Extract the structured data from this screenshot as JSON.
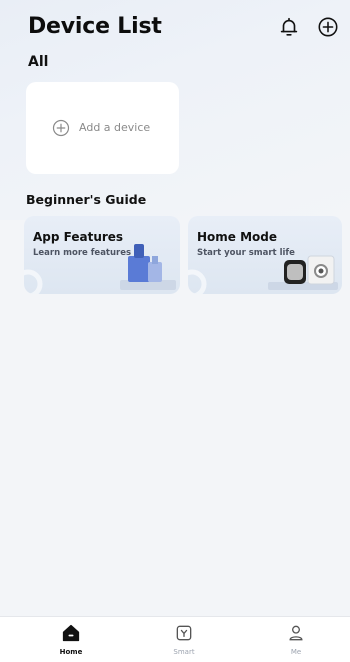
{
  "header": {
    "title": "Device List",
    "notifications_icon": "bell-icon",
    "add_icon": "plus-circle-icon"
  },
  "devices": {
    "section_label": "All",
    "add_card": {
      "label": "Add a device",
      "icon": "plus-circle-icon"
    }
  },
  "guide": {
    "section_label": "Beginner's Guide",
    "cards": [
      {
        "title": "App Features",
        "subtitle": "Learn more features"
      },
      {
        "title": "Home Mode",
        "subtitle": "Start your smart life"
      }
    ]
  },
  "tabbar": {
    "tabs": [
      {
        "label": "Home",
        "icon": "home-icon",
        "active": true
      },
      {
        "label": "Smart",
        "icon": "smart-icon",
        "active": false
      },
      {
        "label": "Me",
        "icon": "user-icon",
        "active": false
      }
    ]
  },
  "colors": {
    "background": "#f3f5f8",
    "card_bg": "#ffffff",
    "guide_card_bg": "#e3eaf4",
    "text_primary": "#111111",
    "text_muted": "#8a8a8a",
    "tab_inactive": "#9ca3af"
  }
}
